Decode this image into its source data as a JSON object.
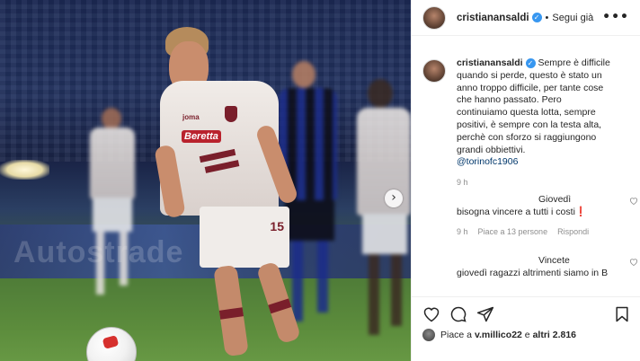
{
  "post": {
    "username": "cristianansaldi",
    "verified_badge": "✓",
    "dot": "•",
    "follow_label": "Segui già",
    "more_label": "•••",
    "caption": {
      "username": "cristianansaldi",
      "text": "Sempre è difficile quando si perde, questo è stato un anno troppo difficile, per tante cose che hanno passato. Pero continuiamo questa lotta, sempre positivi, è sempre con la testa alta, perchè con sforzo si raggiungono grandi obbiettivi.",
      "tag": "@torinofc1906",
      "time": "9 h"
    },
    "comments": [
      {
        "username": "Giovedì",
        "text": "bisogna vincere a tutti i costi❗",
        "time": "9 h",
        "likes": "Piace a 13 persone",
        "reply": "Rispondi"
      },
      {
        "username": "Vincete",
        "text": "giovedì ragazzi altrimenti siamo in B"
      }
    ],
    "likes_line": {
      "prefix": "Piace a",
      "user": "v.millico22",
      "connector": "e",
      "others": "altri 2.816"
    }
  },
  "photo": {
    "jersey_sponsor": "Beretta",
    "jersey_brand": "joma",
    "jersey_number": "15",
    "adboard": "Autostrade",
    "next_arrow": "›"
  },
  "colors": {
    "torino_maroon": "#7a1f2b",
    "link": "#00376b",
    "verified": "#3897f0",
    "muted": "#8e8e8e"
  },
  "icons": [
    "heart-icon",
    "comment-icon",
    "share-icon",
    "bookmark-icon",
    "more-icon",
    "verified-icon",
    "chevron-right-icon"
  ]
}
